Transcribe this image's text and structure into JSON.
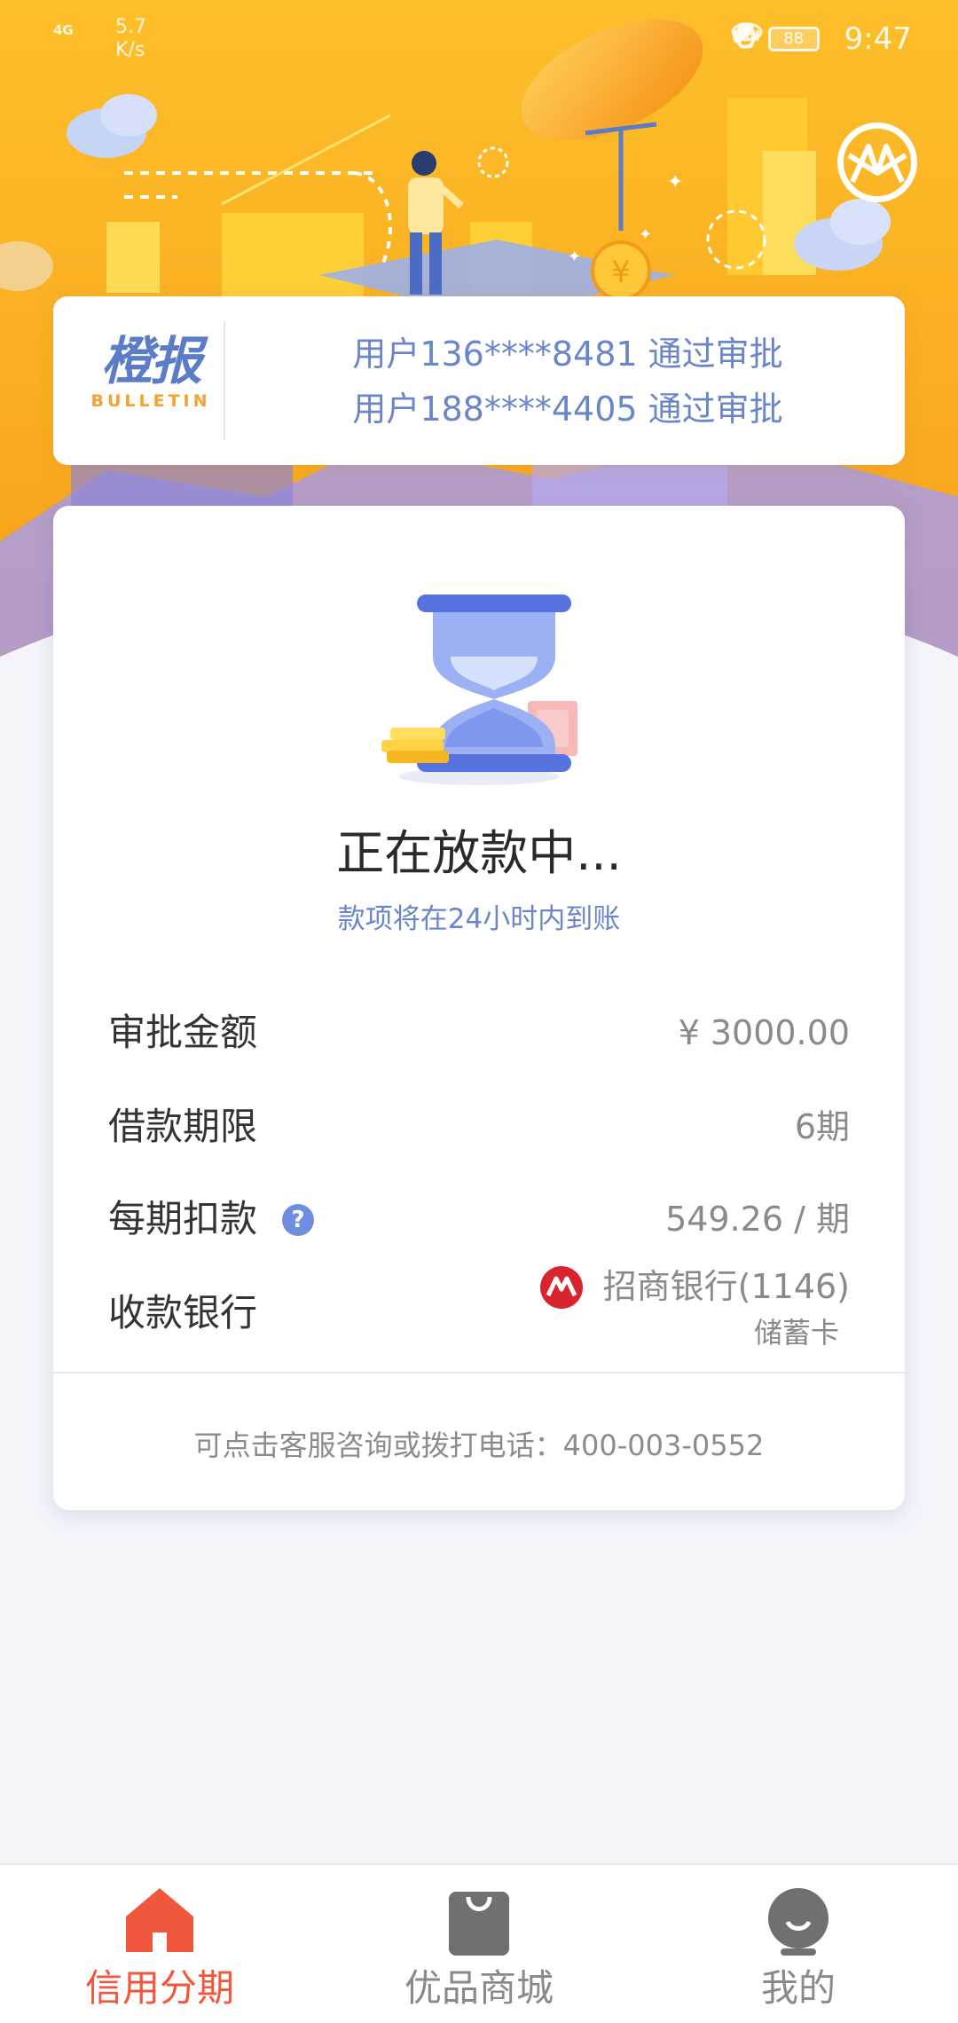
{
  "status_bar": {
    "network_type": "4G",
    "net_speed": "5.7\nK/s",
    "icons": [
      "eye-icon",
      "alarm-icon",
      "vibrate-icon",
      "battery-icon",
      "leaf-icon"
    ],
    "battery_level": "88",
    "time": "9:47"
  },
  "banner": {
    "logo_icon": "m-circle-logo-icon",
    "colors": {
      "primary": "#fcb51e",
      "secondary": "#f7a11a"
    }
  },
  "bulletin": {
    "title": "橙报",
    "subtitle": "BULLETIN",
    "messages": [
      "用户136****8481 通过审批",
      "用户188****4405 通过审批"
    ]
  },
  "status": {
    "icon": "hourglass-icon",
    "title": "正在放款中...",
    "subtitle": "款项将在24小时内到账"
  },
  "details": {
    "approved_amount": {
      "label": "审批金额",
      "value": "¥ 3000.00"
    },
    "loan_term": {
      "label": "借款期限",
      "value": "6期"
    },
    "installment": {
      "label": "每期扣款",
      "value": "549.26 / 期"
    },
    "bank": {
      "label": "收款银行",
      "name": "招商银行(1146)",
      "card_type": "储蓄卡",
      "icon": "cmb-bank-icon",
      "icon_color": "#d9232d"
    }
  },
  "help": {
    "text": "可点击客服咨询或拨打电话：400-003-0552"
  },
  "bottom_nav": {
    "items": [
      {
        "label": "信用分期",
        "icon": "home-icon",
        "active": true
      },
      {
        "label": "优品商城",
        "icon": "shopping-bag-icon",
        "active": false
      },
      {
        "label": "我的",
        "icon": "profile-icon",
        "active": false
      }
    ],
    "active_color": "#f0573d"
  }
}
